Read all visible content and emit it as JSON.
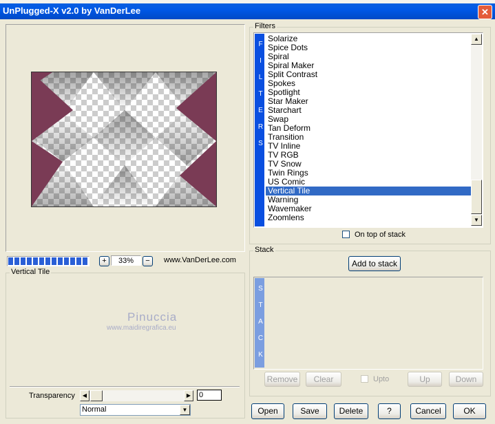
{
  "window": {
    "title": "UnPlugged-X v2.0 by VanDerLee",
    "close_glyph": "✕"
  },
  "preview": {
    "zoom_plus": "+",
    "zoom_value": "33%",
    "zoom_minus": "−",
    "website": "www.VanDerLee.com",
    "progress_fraction": 1.0
  },
  "settings": {
    "group_label": "Vertical Tile",
    "watermark_name": "Pinuccia",
    "watermark_url": "www.maidiregrafica.eu",
    "transparency_label": "Transparency",
    "transparency_value": "0",
    "blend_mode": "Normal",
    "scroll_left": "◀",
    "scroll_right": "▶",
    "dropdown_arrow": "▼"
  },
  "filters": {
    "group_label": "Filters",
    "side_label": "F I L T E R S",
    "items": [
      "Solarize",
      "Spice Dots",
      "Spiral",
      "Spiral Maker",
      "Split Contrast",
      "Spokes",
      "Spotlight",
      "Star Maker",
      "Starchart",
      "Swap",
      "Tan Deform",
      "Transition",
      "TV Inline",
      "TV RGB",
      "TV Snow",
      "Twin Rings",
      "US Comic",
      "Vertical Tile",
      "Warning",
      "Wavemaker",
      "Zoomlens"
    ],
    "selected": "Vertical Tile",
    "on_top_label": "On top of stack",
    "scroll_up": "▲",
    "scroll_down": "▼"
  },
  "stack": {
    "group_label": "Stack",
    "add_button": "Add to stack",
    "side_label": "S T A C K",
    "remove": "Remove",
    "clear": "Clear",
    "upto": "Upto",
    "up": "Up",
    "down": "Down"
  },
  "footer": {
    "open": "Open",
    "save": "Save",
    "delete": "Delete",
    "help": "?",
    "cancel": "Cancel",
    "ok": "OK"
  },
  "colors": {
    "title_bar": "#0058E6",
    "selection": "#316AC5",
    "filter_bar": "#0A4FE0",
    "stack_bar": "#7B9EE0",
    "preview_maroon": "#7A3B55"
  }
}
